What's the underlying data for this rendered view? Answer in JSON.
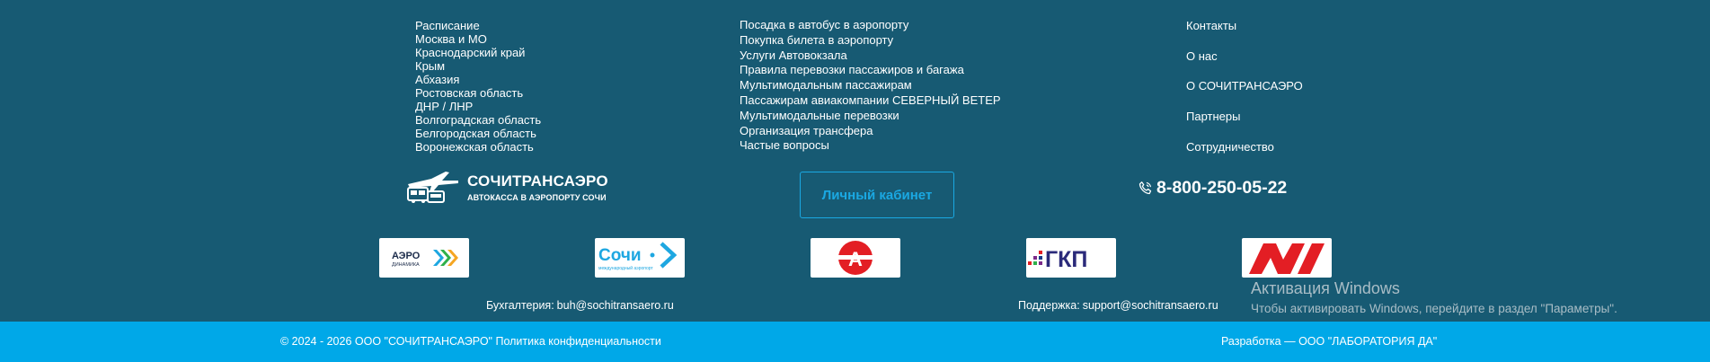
{
  "footer": {
    "col1": [
      "Расписание",
      "Москва и МО",
      "Краснодарский край",
      "Крым",
      "Абхазия",
      "Ростовская область",
      "ДНР / ЛНР",
      "Волгоградская область",
      "Белгородская область",
      "Воронежская область"
    ],
    "col2": [
      "Посадка в автобус в аэропорту",
      "Покупка билета в аэропорту",
      "Услуги Автовокзала",
      "Правила перевозки пассажиров и багажа",
      "Мультимодальным пассажирам",
      "Пассажирам авиакомпании СЕВЕРНЫЙ ВЕТЕР",
      "Мультимодальные перевозки",
      "Организация трансфера",
      "Частые вопросы"
    ],
    "col3": [
      "Контакты",
      "О нас",
      "О СОЧИТРАНСАЭРО",
      "Партнеры",
      "Сотрудничество"
    ]
  },
  "brand": {
    "name": "СОЧИТРАНСАЭРО",
    "tagline": "АВТОКАССА В АЭРОПОРТУ СОЧИ"
  },
  "account_button": "Личный кабинет",
  "phone": "8-800-250-05-22",
  "partners": [
    {
      "icon": "aerodinamika-logo",
      "text": "АЭРО",
      "subtext": "ДИНАМИКА"
    },
    {
      "icon": "sochi-airport-logo",
      "text": "Сочи",
      "subtext": "международный аэропорт"
    },
    {
      "icon": "a-bus-logo",
      "text": "А"
    },
    {
      "icon": "gkp-logo",
      "text": "ГКП"
    },
    {
      "icon": "nordwind-logo"
    }
  ],
  "contacts": {
    "accounting_label": "Бухгалтерия:",
    "accounting_email": "buh@sochitransaero.ru",
    "support_label": "Поддержка:",
    "support_email": "support@sochitransaero.ru"
  },
  "windows_activation": {
    "title": "Активация Windows",
    "subtitle": "Чтобы активировать Windows, перейдите в раздел \"Параметры\"."
  },
  "bottom_bar": {
    "copyright": "© 2024 - 2026 ООО \"СОЧИТРАНСАЭРО\" Политика конфиденциальности",
    "developer": "Разработка — ООО \"ЛАБОРАТОРИЯ ДА\""
  },
  "colors": {
    "background": "#175a73",
    "accent": "#1aa8e2",
    "bottom_bar": "#00a8e8"
  }
}
